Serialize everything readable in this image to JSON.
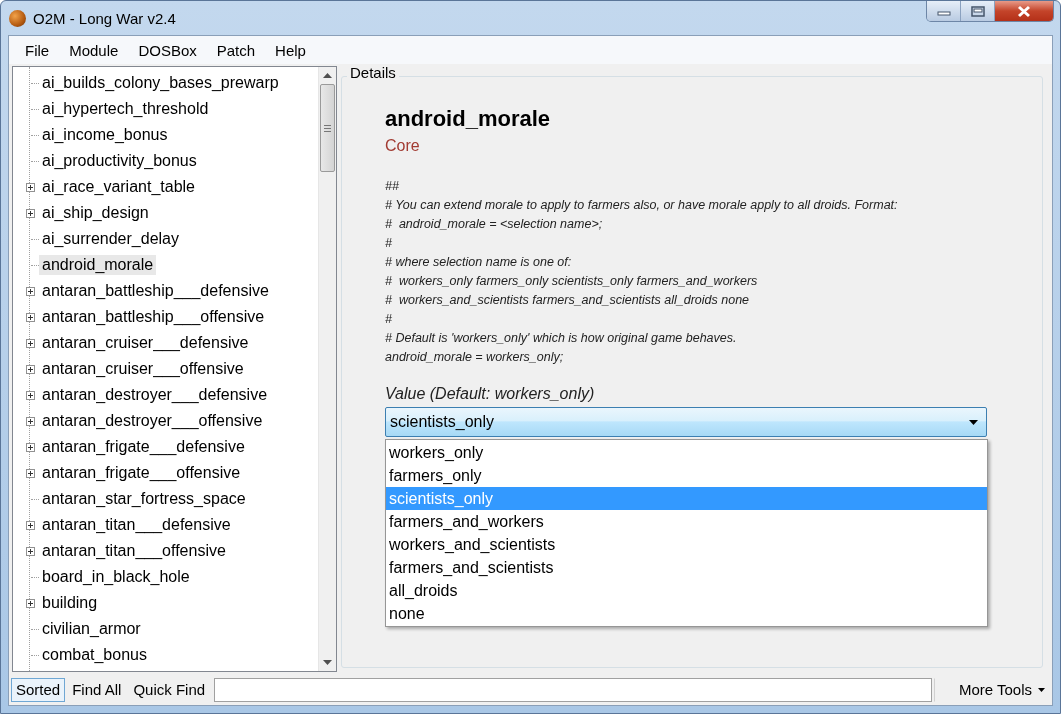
{
  "window": {
    "title": "O2M - Long War v2.4"
  },
  "menu": [
    "File",
    "Module",
    "DOSBox",
    "Patch",
    "Help"
  ],
  "tree": {
    "items": [
      {
        "label": "ai_builds_colony_bases_prewarp",
        "kind": "leaf",
        "selected": false
      },
      {
        "label": "ai_hypertech_threshold",
        "kind": "leaf",
        "selected": false
      },
      {
        "label": "ai_income_bonus",
        "kind": "leaf",
        "selected": false
      },
      {
        "label": "ai_productivity_bonus",
        "kind": "leaf",
        "selected": false
      },
      {
        "label": "ai_race_variant_table",
        "kind": "group",
        "selected": false
      },
      {
        "label": "ai_ship_design",
        "kind": "group",
        "selected": false
      },
      {
        "label": "ai_surrender_delay",
        "kind": "leaf",
        "selected": false
      },
      {
        "label": "android_morale",
        "kind": "leaf",
        "selected": true
      },
      {
        "label": "antaran_battleship___defensive",
        "kind": "group",
        "selected": false
      },
      {
        "label": "antaran_battleship___offensive",
        "kind": "group",
        "selected": false
      },
      {
        "label": "antaran_cruiser___defensive",
        "kind": "group",
        "selected": false
      },
      {
        "label": "antaran_cruiser___offensive",
        "kind": "group",
        "selected": false
      },
      {
        "label": "antaran_destroyer___defensive",
        "kind": "group",
        "selected": false
      },
      {
        "label": "antaran_destroyer___offensive",
        "kind": "group",
        "selected": false
      },
      {
        "label": "antaran_frigate___defensive",
        "kind": "group",
        "selected": false
      },
      {
        "label": "antaran_frigate___offensive",
        "kind": "group",
        "selected": false
      },
      {
        "label": "antaran_star_fortress_space",
        "kind": "leaf",
        "selected": false
      },
      {
        "label": "antaran_titan___defensive",
        "kind": "group",
        "selected": false
      },
      {
        "label": "antaran_titan___offensive",
        "kind": "group",
        "selected": false
      },
      {
        "label": "board_in_black_hole",
        "kind": "leaf",
        "selected": false
      },
      {
        "label": "building",
        "kind": "group",
        "selected": false
      },
      {
        "label": "civilian_armor",
        "kind": "leaf",
        "selected": false
      },
      {
        "label": "combat_bonus",
        "kind": "leaf",
        "selected": false
      }
    ]
  },
  "details": {
    "heading": "Details",
    "name": "android_morale",
    "category": "Core",
    "comment_lines": [
      "##",
      "# You can extend morale to apply to farmers also, or have morale apply to all droids. Format:",
      "#  android_morale = <selection name>;",
      "#",
      "# where selection name is one of:",
      "#  workers_only farmers_only scientists_only farmers_and_workers",
      "#  workers_and_scientists farmers_and_scientists all_droids none",
      "#",
      "# Default is 'workers_only' which is how original game behaves.",
      "android_morale = workers_only;"
    ],
    "value_label": "Value (Default: workers_only)",
    "dropdown": {
      "value": "scientists_only",
      "expanded": true,
      "options": [
        {
          "label": "workers_only",
          "selected": false
        },
        {
          "label": "farmers_only",
          "selected": false
        },
        {
          "label": "scientists_only",
          "selected": true
        },
        {
          "label": "farmers_and_workers",
          "selected": false
        },
        {
          "label": "workers_and_scientists",
          "selected": false
        },
        {
          "label": "farmers_and_scientists",
          "selected": false
        },
        {
          "label": "all_droids",
          "selected": false
        },
        {
          "label": "none",
          "selected": false
        }
      ]
    }
  },
  "toolbar": {
    "sorted": {
      "label": "Sorted",
      "on": true
    },
    "find_all": "Find All",
    "quick_find": "Quick Find",
    "more_tools": "More Tools"
  }
}
